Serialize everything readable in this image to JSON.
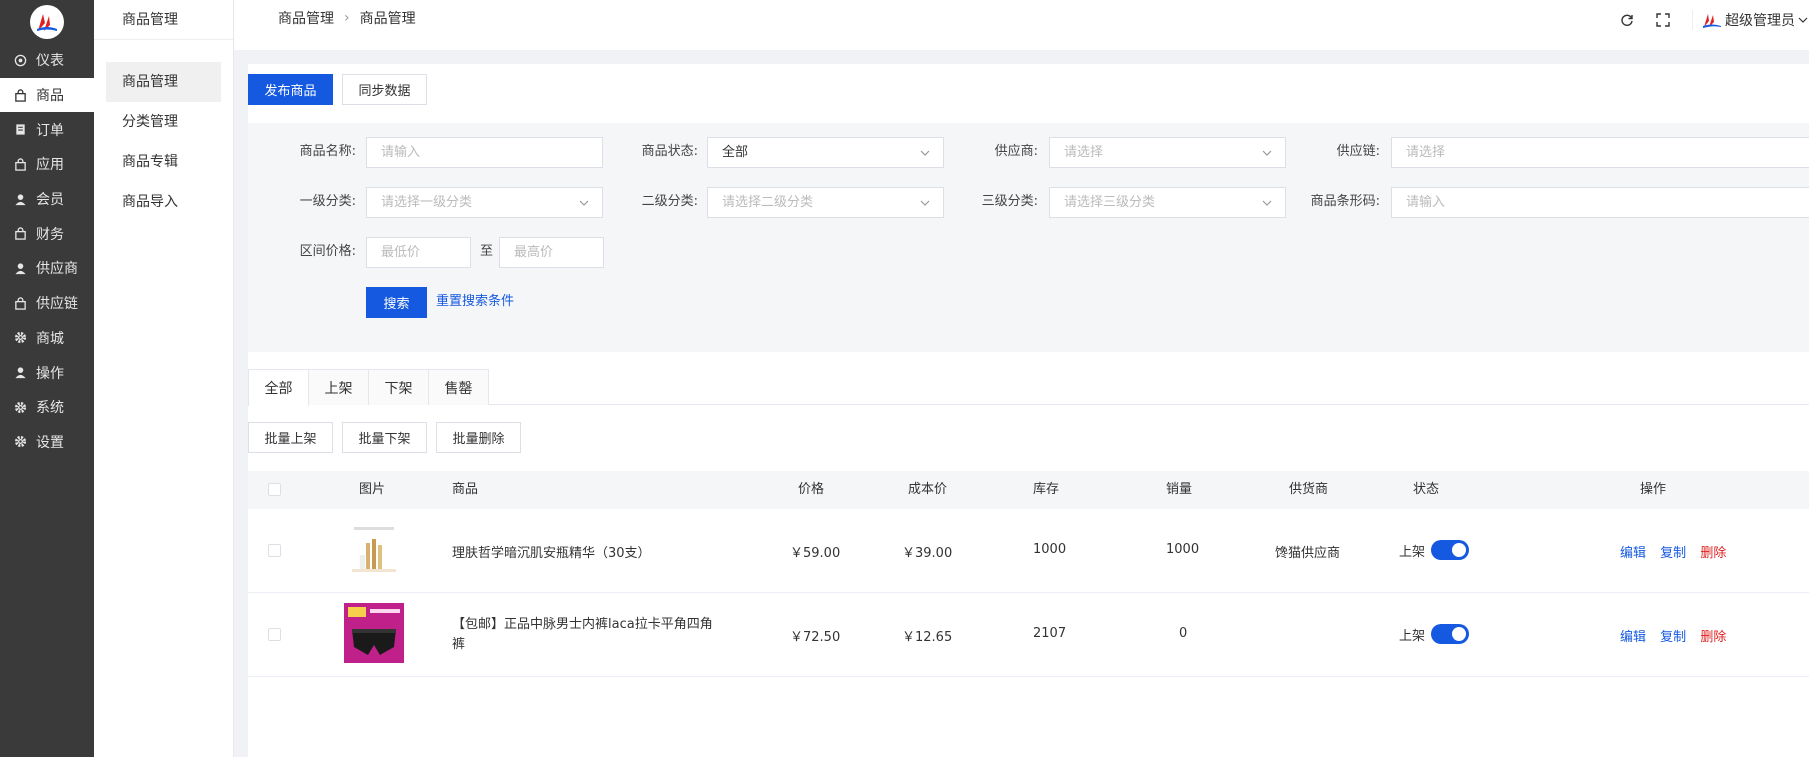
{
  "sidebar": {
    "items": [
      {
        "label": "仪表",
        "icon": "dashboard-icon"
      },
      {
        "label": "商品",
        "icon": "bag-icon"
      },
      {
        "label": "订单",
        "icon": "order-icon"
      },
      {
        "label": "应用",
        "icon": "bag-icon"
      },
      {
        "label": "会员",
        "icon": "user-icon"
      },
      {
        "label": "财务",
        "icon": "bag-icon"
      },
      {
        "label": "供应商",
        "icon": "user-icon"
      },
      {
        "label": "供应链",
        "icon": "bag-icon"
      },
      {
        "label": "商城",
        "icon": "gear-icon"
      },
      {
        "label": "操作",
        "icon": "user-icon"
      },
      {
        "label": "系统",
        "icon": "gear-icon"
      },
      {
        "label": "设置",
        "icon": "gear-icon"
      }
    ]
  },
  "subnav": {
    "title": "商品管理",
    "items": [
      "商品管理",
      "分类管理",
      "商品专辑",
      "商品导入"
    ]
  },
  "header": {
    "breadcrumb": [
      "商品管理",
      "商品管理"
    ],
    "user": "超级管理员"
  },
  "actions": {
    "publish": "发布商品",
    "sync": "同步数据"
  },
  "filter": {
    "name_label": "商品名称:",
    "name_placeholder": "请输入",
    "status_label": "商品状态:",
    "status_value": "全部",
    "supplier_label": "供应商:",
    "supplier_placeholder": "请选择",
    "chain_label": "供应链:",
    "chain_placeholder": "请选择",
    "cat1_label": "一级分类:",
    "cat1_placeholder": "请选择一级分类",
    "cat2_label": "二级分类:",
    "cat2_placeholder": "请选择二级分类",
    "cat3_label": "三级分类:",
    "cat3_placeholder": "请选择三级分类",
    "barcode_label": "商品条形码:",
    "barcode_placeholder": "请输入",
    "price_label": "区间价格:",
    "min_placeholder": "最低价",
    "to": "至",
    "max_placeholder": "最高价",
    "search": "搜索",
    "reset": "重置搜索条件"
  },
  "tabs": [
    "全部",
    "上架",
    "下架",
    "售罄"
  ],
  "batch": {
    "on": "批量上架",
    "off": "批量下架",
    "delete": "批量删除"
  },
  "table": {
    "columns": {
      "image": "图片",
      "product": "商品",
      "price": "价格",
      "cost": "成本价",
      "stock": "库存",
      "sales": "销量",
      "supplier": "供货商",
      "status": "状态",
      "ops": "操作"
    },
    "rows": [
      {
        "name": "理肤哲学暗沉肌安瓶精华（30支）",
        "name2": "",
        "price": "￥59.00",
        "cost": "￥39.00",
        "stock": "1000",
        "sales": "1000",
        "supplier": "馋猫供应商",
        "status": "上架",
        "edit": "编辑",
        "copy": "复制",
        "del": "删除"
      },
      {
        "name": "【包邮】正品中脉男士内裤laca拉卡平角四角",
        "name2": "裤",
        "price": "￥72.50",
        "cost": "￥12.65",
        "stock": "2107",
        "sales": "0",
        "supplier": "",
        "status": "上架",
        "edit": "编辑",
        "copy": "复制",
        "del": "删除"
      }
    ]
  },
  "colors": {
    "primary": "#1559e0",
    "danger": "#e02020",
    "sidebar": "#3a3a3a"
  }
}
